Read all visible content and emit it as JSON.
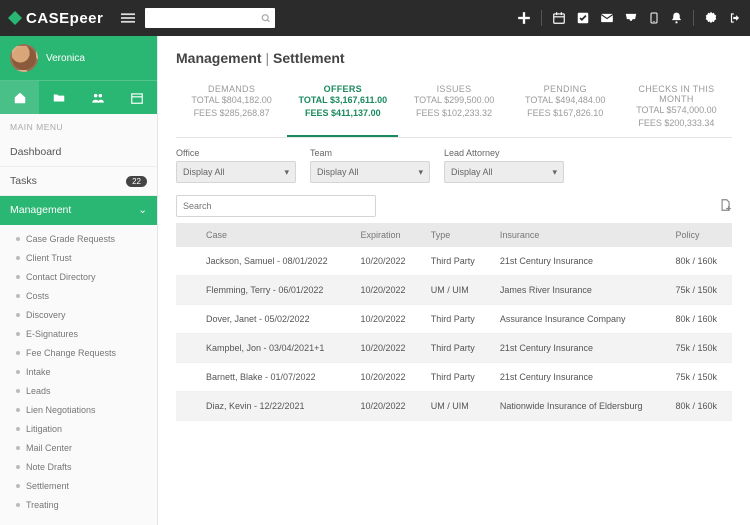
{
  "brand": "CASEpeer",
  "search_placeholder": "",
  "user": {
    "name": "Veronica"
  },
  "sidebar": {
    "header": "MAIN MENU",
    "items": [
      {
        "label": "Dashboard",
        "badge": null,
        "active": false
      },
      {
        "label": "Tasks",
        "badge": "22",
        "active": false
      },
      {
        "label": "Management",
        "badge": null,
        "active": true
      }
    ],
    "sub_items": [
      "Case Grade Requests",
      "Client Trust",
      "Contact Directory",
      "Costs",
      "Discovery",
      "E-Signatures",
      "Fee Change Requests",
      "Intake",
      "Leads",
      "Lien Negotiations",
      "Litigation",
      "Mail Center",
      "Note Drafts",
      "Settlement",
      "Treating"
    ]
  },
  "page": {
    "section": "Management",
    "sub": "Settlement"
  },
  "kpis": [
    {
      "name": "DEMANDS",
      "line1": "TOTAL $804,182.00",
      "line2": "FEES $285,268.87",
      "active": false
    },
    {
      "name": "OFFERS",
      "line1": "TOTAL $3,167,611.00",
      "line2": "FEES $411,137.00",
      "active": true
    },
    {
      "name": "ISSUES",
      "line1": "TOTAL $299,500.00",
      "line2": "FEES $102,233.32",
      "active": false
    },
    {
      "name": "PENDING",
      "line1": "TOTAL $494,484.00",
      "line2": "FEES $167,826.10",
      "active": false
    },
    {
      "name": "CHECKS IN THIS MONTH",
      "line1": "TOTAL $574,000.00",
      "line2": "FEES $200,333.34",
      "active": false
    }
  ],
  "filters": {
    "office": {
      "label": "Office",
      "value": "Display All"
    },
    "team": {
      "label": "Team",
      "value": "Display All"
    },
    "lead": {
      "label": "Lead Attorney",
      "value": "Display All"
    },
    "search_placeholder": "Search"
  },
  "table": {
    "columns": [
      "Case",
      "Expiration",
      "Type",
      "Insurance",
      "Policy"
    ],
    "rows": [
      {
        "case": "Jackson, Samuel - 08/01/2022",
        "exp": "10/20/2022",
        "type": "Third Party",
        "ins": "21st Century Insurance",
        "pol": "80k / 160k"
      },
      {
        "case": "Flemming, Terry - 06/01/2022",
        "exp": "10/20/2022",
        "type": "UM / UIM",
        "ins": "James River Insurance",
        "pol": "75k / 150k"
      },
      {
        "case": "Dover, Janet - 05/02/2022",
        "exp": "10/20/2022",
        "type": "Third Party",
        "ins": "Assurance Insurance Company",
        "pol": "80k / 160k"
      },
      {
        "case": "Kampbel, Jon - 03/04/2021+1",
        "exp": "10/20/2022",
        "type": "Third Party",
        "ins": "21st Century Insurance",
        "pol": "75k / 150k"
      },
      {
        "case": "Barnett, Blake - 01/07/2022",
        "exp": "10/20/2022",
        "type": "Third Party",
        "ins": "21st Century Insurance",
        "pol": "75k / 150k"
      },
      {
        "case": "Diaz, Kevin - 12/22/2021",
        "exp": "10/20/2022",
        "type": "UM / UIM",
        "ins": "Nationwide Insurance of Eldersburg",
        "pol": "80k / 160k"
      }
    ]
  }
}
